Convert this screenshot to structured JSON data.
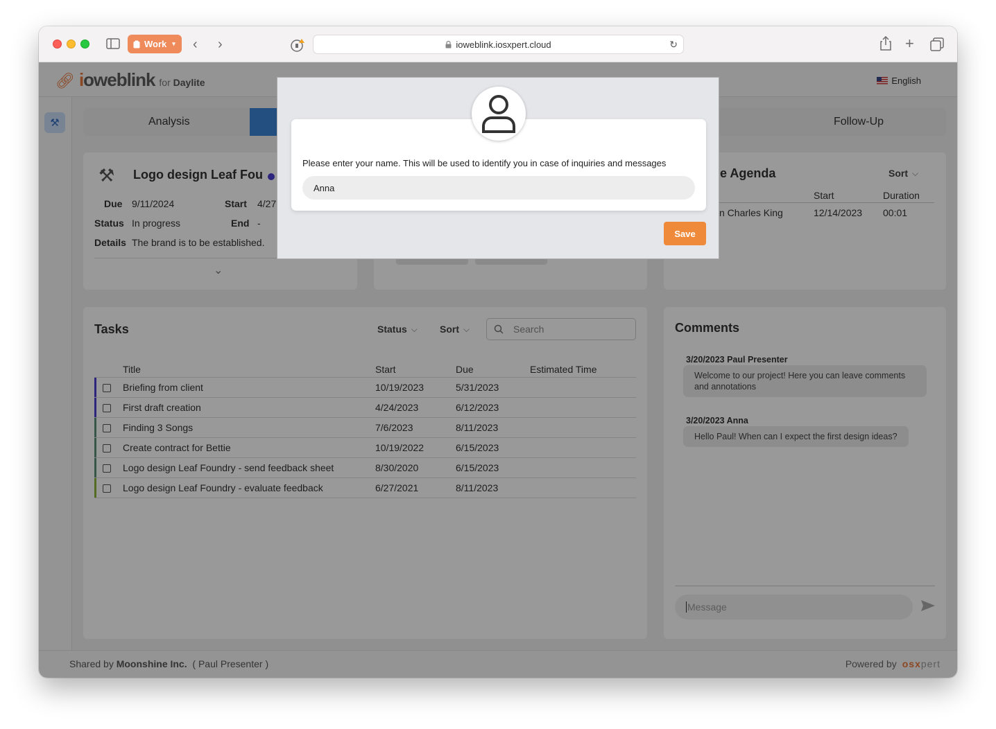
{
  "browser": {
    "tab_group": "Work",
    "url": "ioweblink.iosxpert.cloud"
  },
  "header": {
    "logo_prefix": "i",
    "logo_rest": "oweblink",
    "for": "for",
    "product": "Daylite",
    "language": "English"
  },
  "steps": {
    "first": "Analysis",
    "last": "Follow-Up"
  },
  "project": {
    "title": "Logo design Leaf Fou",
    "due_label": "Due",
    "due": "9/11/2024",
    "start_label": "Start",
    "start": "4/27",
    "status_label": "Status",
    "status": "In progress",
    "end_label": "End",
    "end": "-",
    "details_label": "Details",
    "details": "The brand is to be established."
  },
  "agenda": {
    "title": "ne Agenda",
    "sort": "Sort",
    "col_start": "Start",
    "col_duration": "Duration",
    "row_title": "n Charles King",
    "row_start": "12/14/2023",
    "row_duration": "00:01"
  },
  "tasks": {
    "title": "Tasks",
    "status": "Status",
    "sort": "Sort",
    "search_placeholder": "Search",
    "columns": [
      "Title",
      "Start",
      "Due",
      "Estimated Time"
    ],
    "rows": [
      {
        "title": "Briefing from client",
        "start": "10/19/2023",
        "due": "5/31/2023",
        "est": "",
        "color": "#4b3fd1"
      },
      {
        "title": "First draft creation",
        "start": "4/24/2023",
        "due": "6/12/2023",
        "est": "",
        "color": "#4b3fd1"
      },
      {
        "title": "Finding 3 Songs",
        "start": "7/6/2023",
        "due": "8/11/2023",
        "est": "",
        "color": "#5a8f7a"
      },
      {
        "title": "Create contract for Bettie",
        "start": "10/19/2022",
        "due": "6/15/2023",
        "est": "",
        "color": "#5a8f7a"
      },
      {
        "title": "Logo design Leaf Foundry - send feedback sheet",
        "start": "8/30/2020",
        "due": "6/15/2023",
        "est": "",
        "color": "#5a8f7a"
      },
      {
        "title": "Logo design Leaf Foundry - evaluate feedback",
        "start": "6/27/2021",
        "due": "8/11/2023",
        "est": "",
        "color": "#8db33a"
      }
    ]
  },
  "comments": {
    "title": "Comments",
    "items": [
      {
        "head": "3/20/2023 Paul Presenter",
        "text": "Welcome to our project! Here you can leave comments and annotations"
      },
      {
        "head": "3/20/2023 Anna",
        "text": "Hello Paul! When can I expect the first design ideas?"
      }
    ],
    "message_placeholder": "Message"
  },
  "footer": {
    "shared_by": "Shared by",
    "company": "Moonshine Inc.",
    "person": "( Paul Presenter )",
    "powered_by": "Powered by",
    "brand_a": "osx",
    "brand_b": "pert"
  },
  "modal": {
    "prompt": "Please enter your name. This will be used to identify you in case of inquiries and messages",
    "name_value": "Anna",
    "save": "Save"
  }
}
